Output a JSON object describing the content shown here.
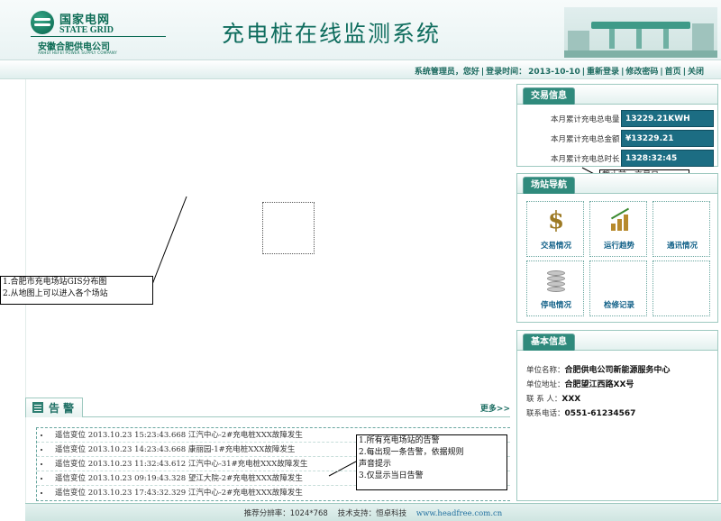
{
  "header": {
    "logo_cn": "国家电网",
    "logo_en": "STATE GRID",
    "company": "安徽合肥供电公司",
    "company_en": "ANHUI HEFEI POWER SUPPLY COMPANY",
    "title": "充电桩在线监测系统"
  },
  "topnav": {
    "greeting": "系统管理员，您好",
    "sep": "|",
    "login_time_label": "登录时间：",
    "login_time": "2013-10-10",
    "relogin": "重新登录",
    "change_password": "修改密码",
    "home": "首页",
    "close": "关闭"
  },
  "annotations": {
    "map_line1": "1.合肥市充电场站GIS分布图",
    "map_line2": "2.从地图上可以进入各个场站",
    "trade_note": "截止前一交易日",
    "alarm_line1": "1.所有充电场站的告警",
    "alarm_line2": "2.每出现一条告警，依据规则",
    "alarm_line3": "声音提示",
    "alarm_line4": "3.仅显示当日告警"
  },
  "alarm": {
    "title": "告警",
    "more": "更多>>",
    "rows": [
      "遥信变位 2013.10.23 15:23:43.668 江汽中心-2#充电桩XXX故障发生",
      "遥信变位 2013.10.23 14:23:43.668 康丽园-1#充电桩XXX故障发生",
      "遥信变位 2013.10.23 11:32:43.612 江汽中心-31#充电桩XXX故障发生",
      "遥信变位 2013.10.23 09:19:43.328 望江大院-2#充电桩XXX故障发生",
      "遥信变位 2013.10.23 17:43:32.329 江汽中心-2#充电桩XXX故障发生"
    ]
  },
  "trade": {
    "title": "交易信息",
    "rows": [
      {
        "label": "本月累计充电总电量：",
        "value": "13229.21KWH"
      },
      {
        "label": "本月累计充电总金额：",
        "value": "¥13229.21"
      },
      {
        "label": "本月累计充电总时长：",
        "value": "1328:32:45"
      }
    ]
  },
  "station_nav": {
    "title": "场站导航",
    "items": [
      "交易情况",
      "运行趋势",
      "通讯情况",
      "停电情况",
      "检修记录",
      ""
    ]
  },
  "basic_info": {
    "title": "基本信息",
    "rows": [
      {
        "label": "单位名称：",
        "value": "合肥供电公司新能源服务中心"
      },
      {
        "label": "单位地址：",
        "value": "合肥望江西路XX号"
      },
      {
        "label": "联 系 人：",
        "value": "XXX"
      },
      {
        "label": "联系电话：",
        "value": "0551-61234567"
      }
    ]
  },
  "footer": {
    "resolution": "推荐分辨率：1024*768",
    "support": "技术支持：恒卓科技",
    "url": "www.headfree.com.cn"
  }
}
